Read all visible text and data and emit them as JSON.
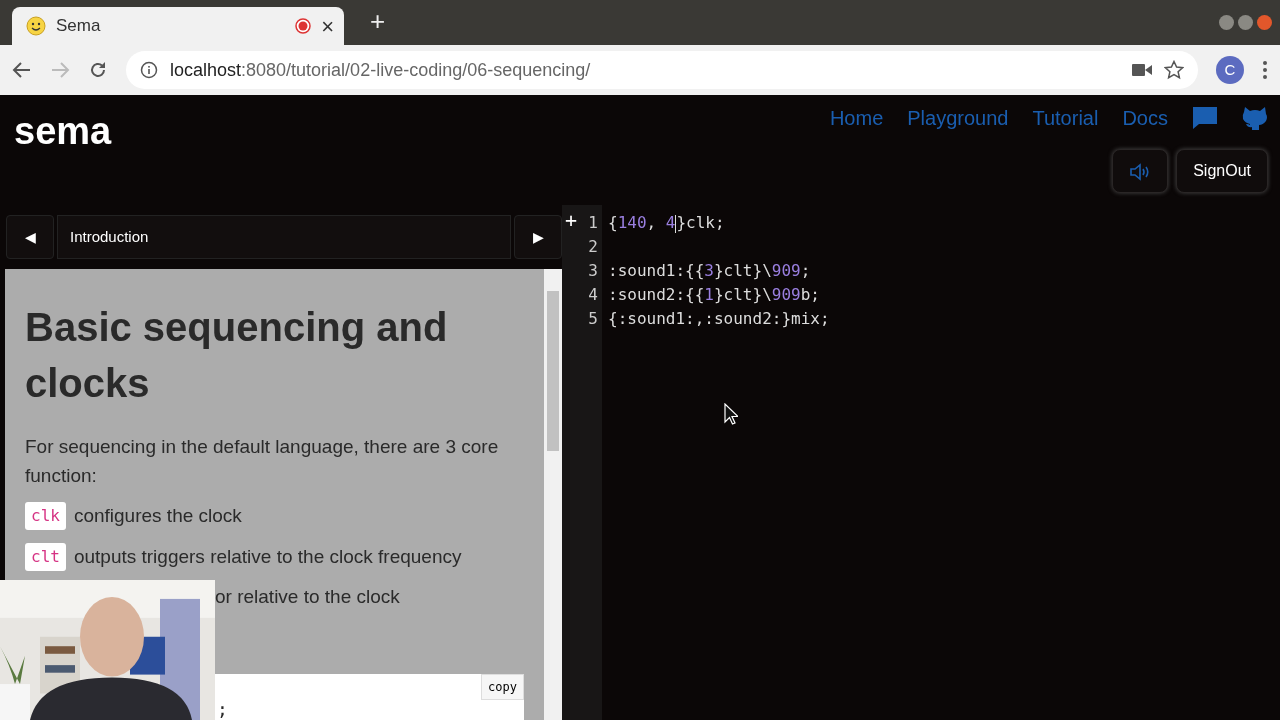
{
  "browser": {
    "tab": {
      "title": "Sema",
      "recording": true,
      "close": "×"
    },
    "new_tab": "+",
    "url_host": "localhost",
    "url_path": ":8080/tutorial/02-live-coding/06-sequencing/",
    "profile": "C",
    "forward_disabled": true
  },
  "site": {
    "logo": "sema",
    "nav": [
      "Home",
      "Playground",
      "Tutorial",
      "Docs"
    ],
    "signout": "SignOut"
  },
  "tutorial": {
    "prev": "◀",
    "next": "▶",
    "chapter": "Introduction",
    "heading": "Basic sequencing and clocks",
    "intro": "For sequencing in the default language, there are 3 core function:",
    "items": [
      {
        "code": "clk",
        "text": "configures the clock"
      },
      {
        "code": "clt",
        "text": "outputs triggers relative to the clock frequency"
      },
      {
        "text": "or relative to the clock"
      }
    ],
    "code_block": {
      "text": ";",
      "copy": "copy"
    }
  },
  "editor": {
    "fold_mark": "+",
    "lines": [
      {
        "number": "1",
        "tokens": [
          {
            "kind": "text",
            "t": "{"
          },
          {
            "kind": "num",
            "t": "140"
          },
          {
            "kind": "text",
            "t": ", "
          },
          {
            "kind": "num",
            "t": "4"
          },
          {
            "kind": "cursor"
          },
          {
            "kind": "text",
            "t": "}clk;"
          }
        ]
      },
      {
        "number": "2"
      },
      {
        "number": "3",
        "tokens": [
          {
            "kind": "text",
            "t": ":sound1:{{"
          },
          {
            "kind": "num",
            "t": "3"
          },
          {
            "kind": "text",
            "t": "}clt}\\"
          },
          {
            "kind": "num",
            "t": "909"
          },
          {
            "kind": "text",
            "t": ";"
          }
        ]
      },
      {
        "number": "4",
        "tokens": [
          {
            "kind": "text",
            "t": ":sound2:{{"
          },
          {
            "kind": "num",
            "t": "1"
          },
          {
            "kind": "text",
            "t": "}clt}\\"
          },
          {
            "kind": "num",
            "t": "909"
          },
          {
            "kind": "text",
            "t": "b;"
          }
        ]
      },
      {
        "number": "5",
        "tokens": [
          {
            "kind": "text",
            "t": "{:sound1:,:sound2:}mix;"
          }
        ]
      }
    ]
  }
}
